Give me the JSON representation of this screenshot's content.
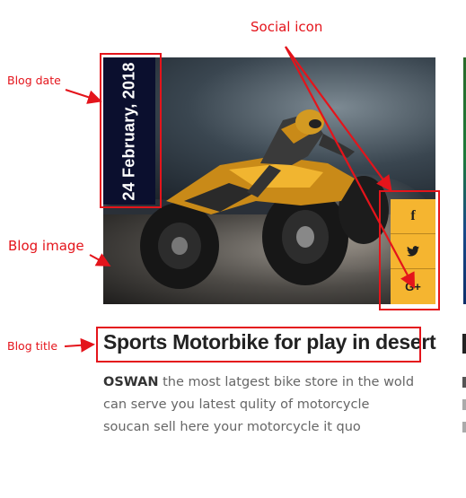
{
  "annotations": {
    "blog_date": "Blog date",
    "social_icon": "Social icon",
    "blog_image": "Blog image",
    "blog_title": "Blog title",
    "color": "#e4141b"
  },
  "blog": {
    "date": "24 February, 2018",
    "title": "Sports Motorbike for play in desert",
    "excerpt_brand": "OSWAN",
    "excerpt_text": " the most latgest bike store in the wold can serve you latest qulity of motorcycle soucan sell here your motorcycle it quo",
    "social": [
      {
        "icon": "facebook-icon",
        "glyph": "f"
      },
      {
        "icon": "twitter-icon",
        "glyph": "🐦"
      },
      {
        "icon": "google-plus-icon",
        "glyph": "G+"
      }
    ],
    "accent_color": "#f5b530",
    "date_bg": "#0b0f2e"
  }
}
